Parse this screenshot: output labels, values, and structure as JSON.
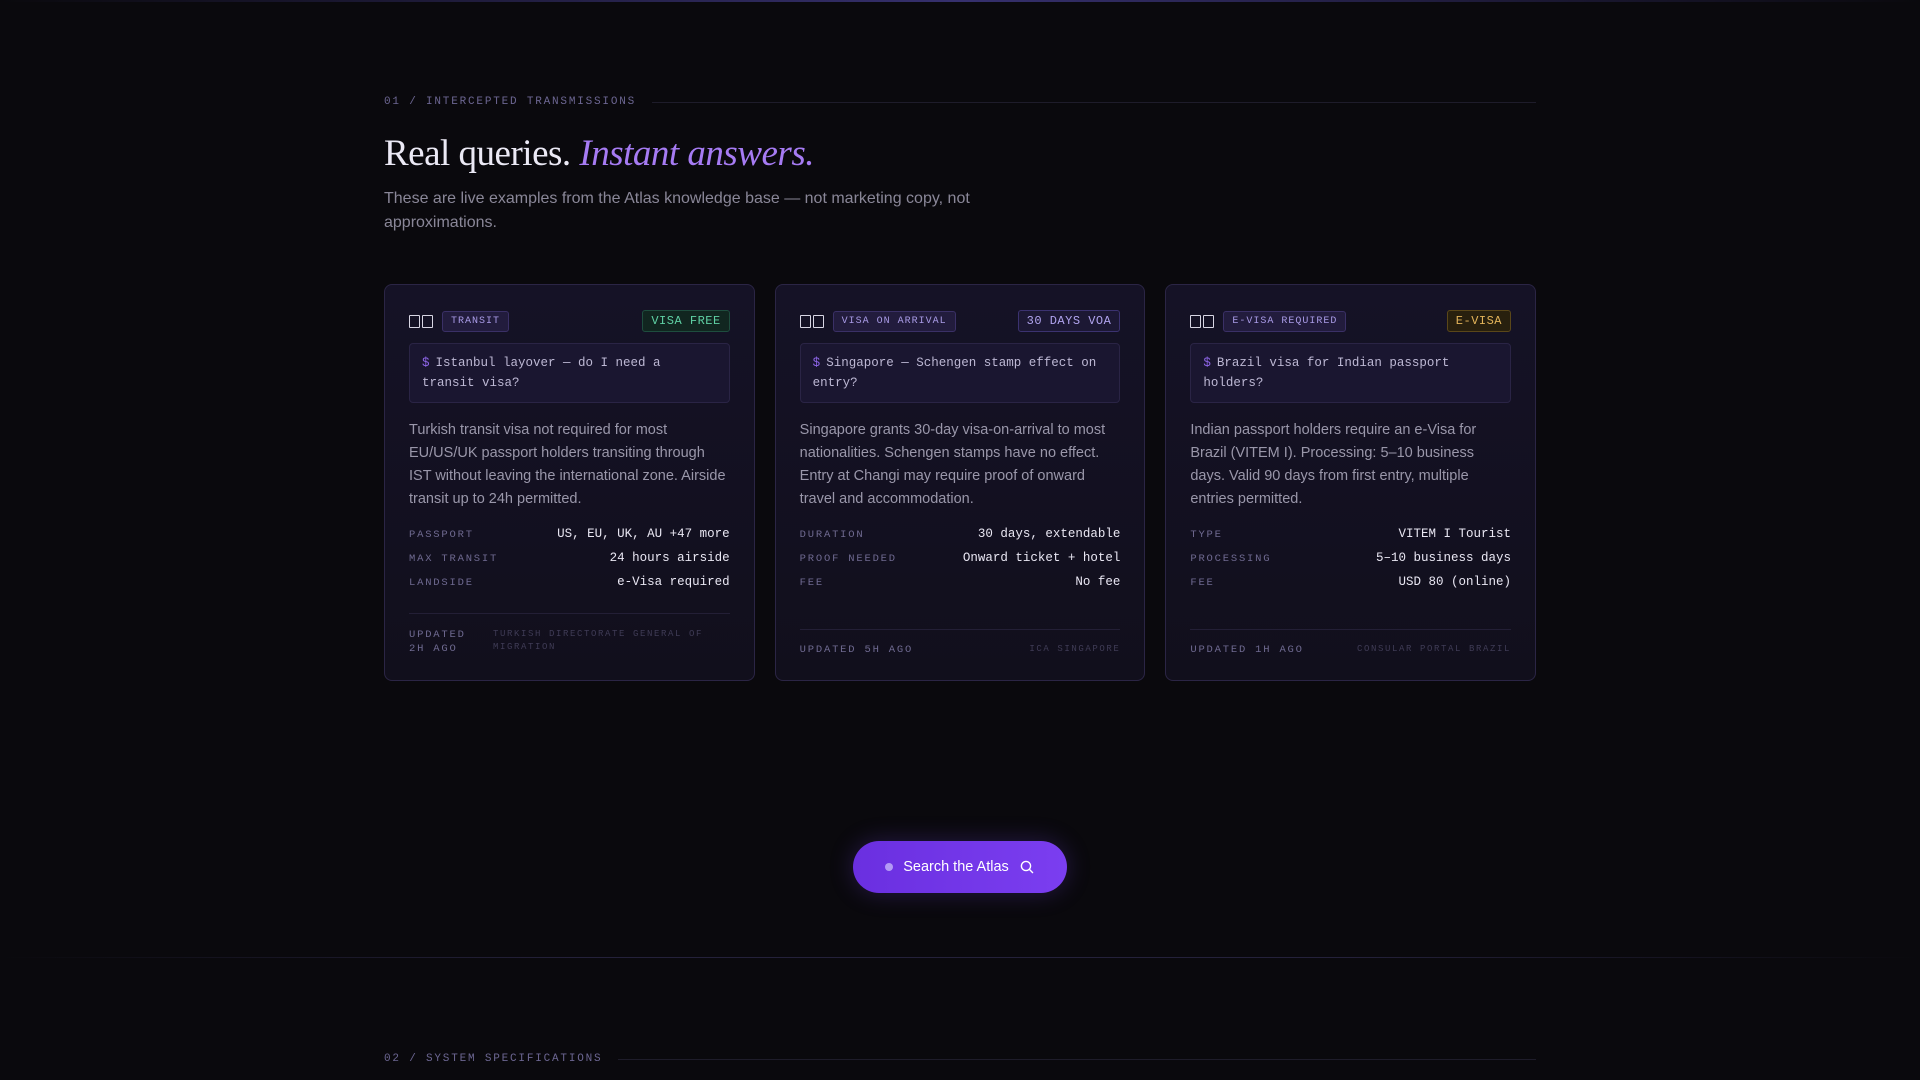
{
  "section1": {
    "label": "01 / INTERCEPTED TRANSMISSIONS",
    "headline_plain": "Real queries.",
    "headline_accent": "Instant answers.",
    "subtext": "These are live examples from the Atlas knowledge base — not marketing copy, not approximations."
  },
  "cards": [
    {
      "flag_icon": "flag-icon",
      "kind": "TRANSIT",
      "status": "VISA FREE",
      "status_color": "#5fd0a4",
      "prompt_symbol": "$",
      "query": "Istanbul layover — do I need a transit visa?",
      "answer": "Turkish transit visa not required for most EU/US/UK passport holders transiting through IST without leaving the international zone. Airside transit up to 24h permitted.",
      "facts": [
        {
          "key": "PASSPORT",
          "value": "US, EU, UK, AU +47 more"
        },
        {
          "key": "MAX TRANSIT",
          "value": "24 hours airside"
        },
        {
          "key": "LANDSIDE",
          "value": "e-Visa required"
        }
      ],
      "updated": "UPDATED 2H AGO",
      "source": "TURKISH DIRECTORATE GENERAL OF MIGRATION"
    },
    {
      "flag_icon": "flag-icon",
      "kind": "VISA ON ARRIVAL",
      "status": "30 DAYS VOA",
      "status_color": "#b1a4ef",
      "prompt_symbol": "$",
      "query": "Singapore — Schengen stamp effect on entry?",
      "answer": "Singapore grants 30-day visa-on-arrival to most nationalities. Schengen stamps have no effect. Entry at Changi may require proof of onward travel and accommodation.",
      "facts": [
        {
          "key": "DURATION",
          "value": "30 days, extendable"
        },
        {
          "key": "PROOF NEEDED",
          "value": "Onward ticket + hotel"
        },
        {
          "key": "FEE",
          "value": "No fee"
        }
      ],
      "updated": "UPDATED 5H AGO",
      "source": "ICA SINGAPORE"
    },
    {
      "flag_icon": "flag-icon",
      "kind": "E-VISA REQUIRED",
      "status": "E-VISA",
      "status_color": "#e3b45a",
      "prompt_symbol": "$",
      "query": "Brazil visa for Indian passport holders?",
      "answer": "Indian passport holders require an e-Visa for Brazil (VITEM I). Processing: 5–10 business days. Valid 90 days from first entry, multiple entries permitted.",
      "facts": [
        {
          "key": "TYPE",
          "value": "VITEM I Tourist"
        },
        {
          "key": "PROCESSING",
          "value": "5–10 business days"
        },
        {
          "key": "FEE",
          "value": "USD 80 (online)"
        }
      ],
      "updated": "UPDATED 1H AGO",
      "source": "CONSULAR PORTAL BRAZIL"
    }
  ],
  "cta": {
    "label": "Search the Atlas",
    "icon": "search-icon"
  },
  "section2": {
    "label": "02 / SYSTEM SPECIFICATIONS"
  }
}
